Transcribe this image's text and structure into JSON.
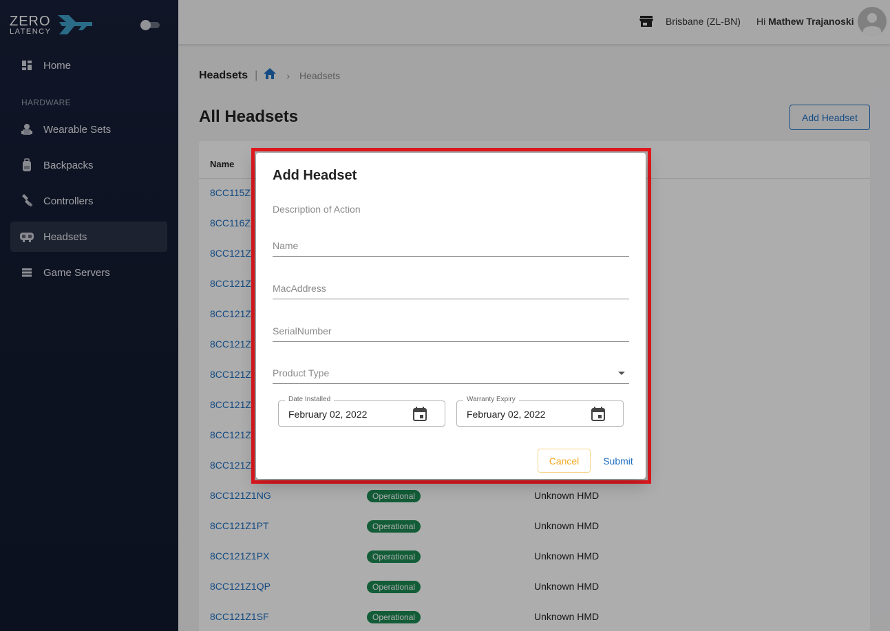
{
  "brand": {
    "line1": "ZERO",
    "line2": "LATENCY",
    "accent_color": "#3e9ec8"
  },
  "sidebar": {
    "section_label": "HARDWARE",
    "items": [
      {
        "label": "Home",
        "icon": "dashboard-icon"
      },
      {
        "label": "Wearable Sets",
        "icon": "wearable-icon"
      },
      {
        "label": "Backpacks",
        "icon": "backpack-icon"
      },
      {
        "label": "Controllers",
        "icon": "controller-icon"
      },
      {
        "label": "Headsets",
        "icon": "headset-icon",
        "active": true
      },
      {
        "label": "Game Servers",
        "icon": "server-icon"
      }
    ]
  },
  "topbar": {
    "location": "Brisbane (ZL-BN)",
    "greeting_prefix": "Hi",
    "user_name": "Mathew Trajanoski"
  },
  "breadcrumb": {
    "title": "Headsets",
    "separator": "|",
    "current": "Headsets"
  },
  "page": {
    "title": "All Headsets",
    "add_button": "Add Headset"
  },
  "table": {
    "columns": [
      "Name"
    ],
    "rows": [
      {
        "name": "8CC115Z"
      },
      {
        "name": "8CC116Z"
      },
      {
        "name": "8CC121Z"
      },
      {
        "name": "8CC121Z"
      },
      {
        "name": "8CC121Z"
      },
      {
        "name": "8CC121Z"
      },
      {
        "name": "8CC121Z"
      },
      {
        "name": "8CC121Z"
      },
      {
        "name": "8CC121Z"
      },
      {
        "name": "8CC121Z"
      },
      {
        "name": "8CC121Z1NG",
        "status": "Operational",
        "type": "Unknown HMD"
      },
      {
        "name": "8CC121Z1PT",
        "status": "Operational",
        "type": "Unknown HMD"
      },
      {
        "name": "8CC121Z1PX",
        "status": "Operational",
        "type": "Unknown HMD"
      },
      {
        "name": "8CC121Z1QP",
        "status": "Operational",
        "type": "Unknown HMD"
      },
      {
        "name": "8CC121Z1SF",
        "status": "Operational",
        "type": "Unknown HMD"
      }
    ]
  },
  "dialog": {
    "title": "Add Headset",
    "description": "Description of Action",
    "fields": {
      "name_placeholder": "Name",
      "mac_placeholder": "MacAddress",
      "serial_placeholder": "SerialNumber",
      "product_type_label": "Product Type"
    },
    "date_installed": {
      "label": "Date Installed",
      "value": "February 02, 2022"
    },
    "warranty_expiry": {
      "label": "Warranty Expiry",
      "value": "February 02, 2022"
    },
    "cancel_label": "Cancel",
    "submit_label": "Submit"
  }
}
